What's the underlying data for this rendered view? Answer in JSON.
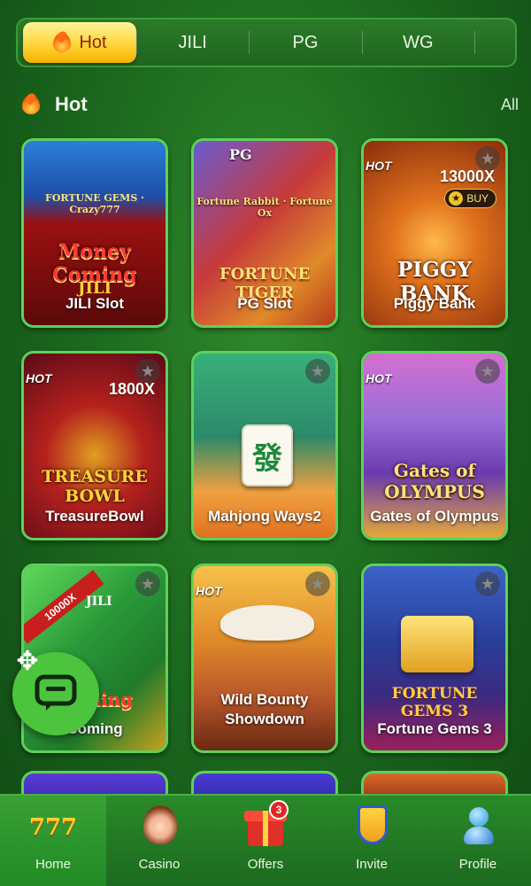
{
  "provider_tabs": [
    {
      "label": "Hot",
      "icon": "flame-icon",
      "active": true
    },
    {
      "label": "JILI"
    },
    {
      "label": "PG"
    },
    {
      "label": "WG"
    }
  ],
  "section": {
    "title": "Hot",
    "icon": "flame-icon",
    "all_label": "All"
  },
  "games": [
    {
      "name": "JILI Slot",
      "art_title": "Money Coming",
      "art_sub": "JILI",
      "extra": "FORTUNE GEMS · Crazy777"
    },
    {
      "name": "PG Slot",
      "art_title": "FORTUNE TIGER",
      "art_sub": "Fortune Rabbit · Fortune Ox",
      "badge": "PG"
    },
    {
      "name": "Piggy Bank",
      "art_title": "PIGGY BANK",
      "hot": "HOT",
      "multiplier": "13000X",
      "buy": "BUY"
    },
    {
      "name": "TreasureBowl",
      "art_title": "TREASURE BOWL",
      "hot": "HOT",
      "multiplier": "1800X"
    },
    {
      "name": "Mahjong Ways2",
      "art_title": "發"
    },
    {
      "name": "Gates of Olympus",
      "art_title": "Gates of OLYMPUS",
      "hot": "HOT"
    },
    {
      "name": "Coming",
      "art_title": "Coming",
      "ribbon": "10000X",
      "art_sub": "JILI"
    },
    {
      "name_line1": "Wild Bounty",
      "name_line2": "Showdown",
      "hot": "HOT"
    },
    {
      "name": "Fortune Gems 3",
      "art_title": "FORTUNE GEMS 3"
    }
  ],
  "favorite_icon": "★",
  "bottom_nav": [
    {
      "label": "Home",
      "icon": "slot-777-icon",
      "active": true
    },
    {
      "label": "Casino",
      "icon": "casino-girl-icon"
    },
    {
      "label": "Offers",
      "icon": "gift-icon",
      "badge": "3"
    },
    {
      "label": "Invite",
      "icon": "shield-invite-icon"
    },
    {
      "label": "Profile",
      "icon": "profile-icon"
    }
  ],
  "colors": {
    "accent": "#ffd43b",
    "card_border": "#5fd05b",
    "background": "#1d6b1f"
  }
}
